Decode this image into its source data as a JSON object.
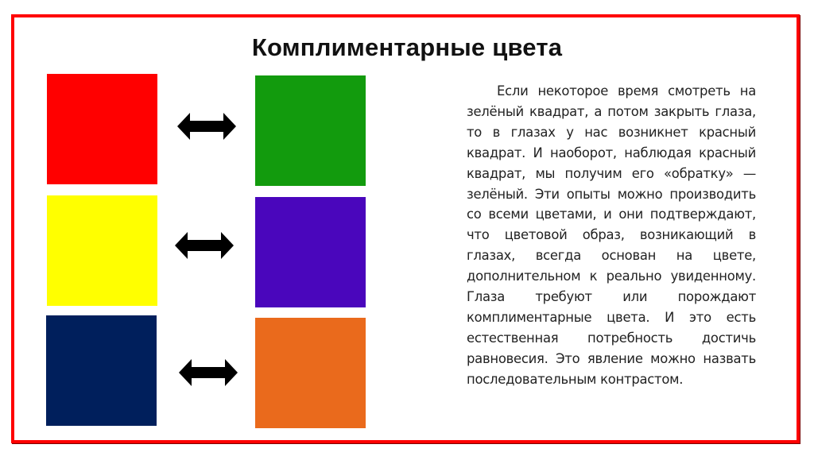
{
  "slide": {
    "title": "Комплиментарные цвета",
    "frame_color": "#ff0000",
    "body_text": "Если некоторое время смотреть на зелёный квадрат, а потом закрыть глаза, то в глазах у нас возникнет красный квадрат. И наоборот, наблюдая красный квадрат, мы получим его «обратку» — зелёный. Эти опыты можно производить со всеми цветами, и они подтверждают, что цветовой образ, возникающий в глазах, всегда основан на цвете, дополнительном к реально увиденному. Глаза требуют или порождают комплиментарные цвета. И это есть естественная потребность достичь равновесия.  Это явление можно назвать последовательным контрастом."
  },
  "color_pairs": [
    {
      "left": {
        "name": "red",
        "color": "#ff0000"
      },
      "arrow_icon": "double-arrow-icon",
      "right": {
        "name": "green",
        "color": "#129b0d"
      }
    },
    {
      "left": {
        "name": "yellow",
        "color": "#ffff00"
      },
      "arrow_icon": "double-arrow-icon",
      "right": {
        "name": "violet",
        "color": "#4a06bc"
      }
    },
    {
      "left": {
        "name": "dark-blue",
        "color": "#001f5c"
      },
      "arrow_icon": "double-arrow-icon",
      "right": {
        "name": "orange",
        "color": "#ea6a1c"
      }
    }
  ]
}
